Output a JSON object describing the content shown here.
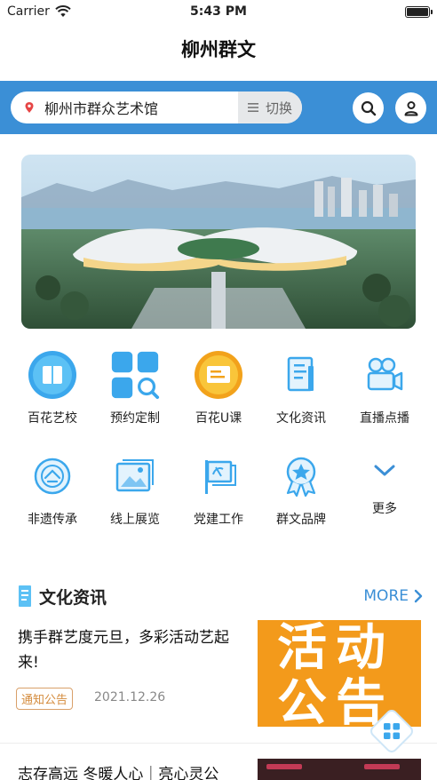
{
  "status": {
    "carrier": "Carrier",
    "time": "5:43 PM"
  },
  "header": {
    "title": "柳州群文"
  },
  "search": {
    "location": "柳州市群众艺术馆",
    "switch_label": "切换"
  },
  "grid": [
    {
      "label": "百花艺校",
      "icon": "book-icon"
    },
    {
      "label": "预约定制",
      "icon": "apps-search-icon"
    },
    {
      "label": "百花U课",
      "icon": "course-icon"
    },
    {
      "label": "文化资讯",
      "icon": "news-icon"
    },
    {
      "label": "直播点播",
      "icon": "video-camera-icon"
    },
    {
      "label": "非遗传承",
      "icon": "heritage-icon"
    },
    {
      "label": "线上展览",
      "icon": "gallery-icon"
    },
    {
      "label": "党建工作",
      "icon": "party-flag-icon"
    },
    {
      "label": "群文品牌",
      "icon": "brand-badge-icon"
    },
    {
      "label": "更多",
      "icon": "chevron-down-icon"
    }
  ],
  "section": {
    "title": "文化资讯",
    "more": "MORE"
  },
  "news": [
    {
      "title": "携手群艺度元旦，多彩活动艺起来!",
      "tag": "通知公告",
      "date": "2021.12.26",
      "thumb_text_1": "活动",
      "thumb_text_2": "公告"
    },
    {
      "title": "志存高远 冬暖人心｜亮心灵公"
    }
  ],
  "colors": {
    "accent": "#3b8fd6",
    "tag": "#d48b3c",
    "thumb_bg": "#f39a1b"
  }
}
